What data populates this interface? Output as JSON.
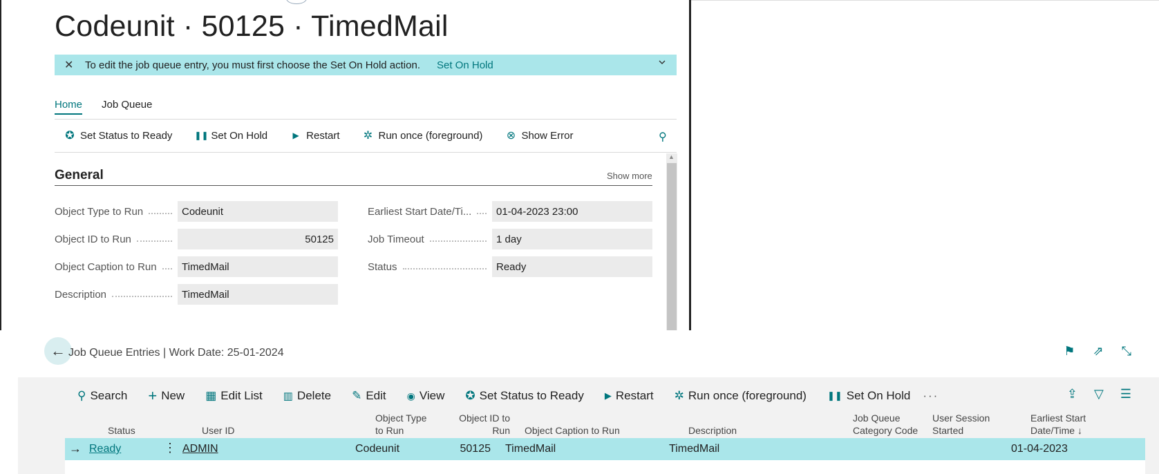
{
  "card": {
    "title": "Codeunit · 50125 · TimedMail",
    "banner": {
      "message": "To edit the job queue entry, you must first choose the Set On Hold action.",
      "link": "Set On Hold"
    },
    "tabs": [
      "Home",
      "Job Queue"
    ],
    "actions": [
      {
        "label": "Set Status to Ready",
        "icon": "set-status-ready-icon",
        "glyph": "✪"
      },
      {
        "label": "Set On Hold",
        "icon": "pause-icon",
        "glyph": "❚❚"
      },
      {
        "label": "Restart",
        "icon": "play-icon",
        "glyph": "▶"
      },
      {
        "label": "Run once (foreground)",
        "icon": "run-once-icon",
        "glyph": "✲"
      },
      {
        "label": "Show Error",
        "icon": "error-icon",
        "glyph": "⊗"
      }
    ],
    "section": {
      "title": "General",
      "show_more": "Show more"
    },
    "fields_left": [
      {
        "label": "Object Type to Run",
        "value": "Codeunit",
        "align": "left"
      },
      {
        "label": "Object ID to Run",
        "value": "50125",
        "align": "right"
      },
      {
        "label": "Object Caption to Run",
        "value": "TimedMail",
        "align": "left"
      },
      {
        "label": "Description",
        "value": "TimedMail",
        "align": "left"
      }
    ],
    "fields_right": [
      {
        "label": "Earliest Start Date/Ti...",
        "value": "01-04-2023 23:00"
      },
      {
        "label": "Job Timeout",
        "value": "1 day"
      },
      {
        "label": "Status",
        "value": "Ready"
      }
    ]
  },
  "list": {
    "title": "Job Queue Entries | Work Date: 25-01-2024",
    "actions": [
      {
        "label": "Search",
        "icon": "search-icon",
        "glyph": "⚲"
      },
      {
        "label": "New",
        "icon": "plus-icon",
        "glyph": "+"
      },
      {
        "label": "Edit List",
        "icon": "edit-list-icon",
        "glyph": "▦"
      },
      {
        "label": "Delete",
        "icon": "trash-icon",
        "glyph": "🗑"
      },
      {
        "label": "Edit",
        "icon": "pencil-icon",
        "glyph": "✎"
      },
      {
        "label": "View",
        "icon": "eye-icon",
        "glyph": "◉"
      },
      {
        "label": "Set Status to Ready",
        "icon": "set-status-ready-icon",
        "glyph": "✪"
      },
      {
        "label": "Restart",
        "icon": "play-icon",
        "glyph": "▶"
      },
      {
        "label": "Run once (foreground)",
        "icon": "run-once-icon",
        "glyph": "✲"
      },
      {
        "label": "Set On Hold",
        "icon": "pause-icon",
        "glyph": "❚❚"
      }
    ],
    "more": "···",
    "columns": {
      "status": "Status",
      "user_id": "User ID",
      "object_type_1": "Object Type",
      "object_type_2": "to Run",
      "object_id_1": "Object ID to",
      "object_id_2": "Run",
      "object_caption": "Object Caption to Run",
      "description": "Description",
      "category_1": "Job Queue",
      "category_2": "Category Code",
      "session_1": "User Session",
      "session_2": "Started",
      "earliest_1": "Earliest Start",
      "earliest_2": "Date/Time ↓"
    },
    "row": {
      "status": "Ready",
      "user_id": "ADMIN",
      "object_type": "Codeunit",
      "object_id": "50125",
      "object_caption": "TimedMail",
      "description": "TimedMail",
      "earliest": "01-04-2023"
    }
  },
  "colors": {
    "accent": "#00767d",
    "banner": "#aae6ea",
    "field_bg": "#ebebeb"
  }
}
